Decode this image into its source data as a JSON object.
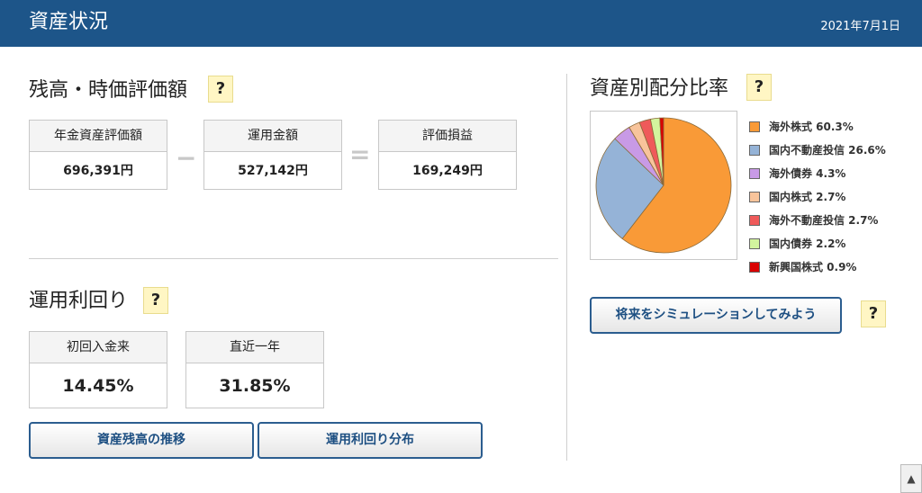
{
  "header": {
    "title": "資産状況",
    "date": "2021年7月1日"
  },
  "balance": {
    "title": "残高・時価評価額",
    "help": "?",
    "operators": {
      "minus": "−",
      "equals": "="
    },
    "items": [
      {
        "label": "年金資産評価額",
        "value": "696,391円"
      },
      {
        "label": "運用金額",
        "value": "527,142円"
      },
      {
        "label": "評価損益",
        "value": "169,249円"
      }
    ]
  },
  "yield": {
    "title": "運用利回り",
    "help": "?",
    "items": [
      {
        "label": "初回入金来",
        "value": "14.45%"
      },
      {
        "label": "直近一年",
        "value": "31.85%"
      }
    ]
  },
  "buttons": {
    "balance_history": "資産残高の推移",
    "yield_distribution": "運用利回り分布",
    "simulate": "将来をシミュレーションしてみよう"
  },
  "allocation": {
    "title": "資産別配分比率",
    "help": "?",
    "simulate_help": "?"
  },
  "chart_data": {
    "type": "pie",
    "categories": [
      "海外株式",
      "国内不動産投信",
      "海外債券",
      "国内株式",
      "海外不動産投信",
      "国内債券",
      "新興国株式"
    ],
    "values": [
      60.3,
      26.6,
      4.3,
      2.7,
      2.7,
      2.2,
      0.9
    ],
    "legend_labels": [
      "海外株式 60.3%",
      "国内不動産投信 26.6%",
      "海外債券 4.3%",
      "国内株式 2.7%",
      "海外不動産投信 2.7%",
      "国内債券 2.2%",
      "新興国株式 0.9%"
    ],
    "colors": [
      "#f99a37",
      "#95b3d7",
      "#c89ae6",
      "#f8c49b",
      "#ef5a5a",
      "#d3f59e",
      "#d90000"
    ],
    "legend_position": "right"
  },
  "scroll": {
    "up_glyph": "▲"
  }
}
